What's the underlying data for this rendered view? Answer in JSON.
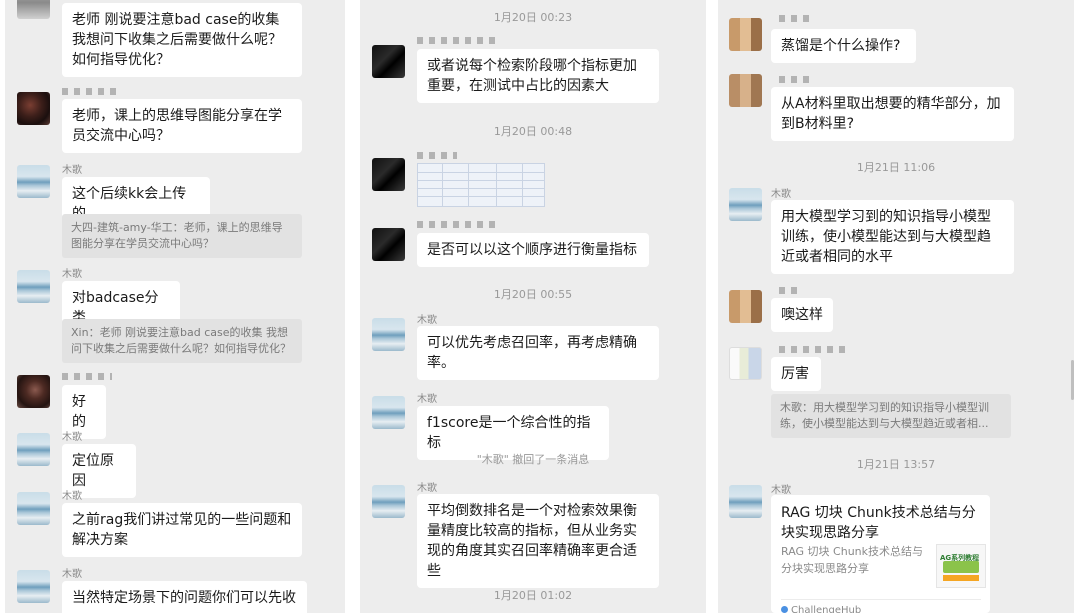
{
  "col1": {
    "msg1": "老师 刚说要注意bad case的收集 我想问下收集之后需要做什么呢？如何指导优化？",
    "msg2": "老师，课上的思维导图能分享在学员交流中心吗？",
    "mu_name": "木歌",
    "msg3": "这个后续kk会上传的",
    "quote1": "大四-建筑-amy-华工：老师，课上的思维导图能分享在学员交流中心吗？",
    "msg4": "对badcase分类",
    "quote2": "Xin：老师 刚说要注意bad case的收集 我想问下收集之后需要做什么呢？如何指导优化？",
    "msg5": "好的",
    "msg6": "定位原因",
    "msg7": "之前rag我们讲过常见的一些问题和解决方案",
    "msg8": "当然特定场景下的问题你们可以先收"
  },
  "col2": {
    "time1": "1月20日 00:23",
    "msg1": "或者说每个检索阶段哪个指标更加重要，在测试中占比的因素大",
    "time2": "1月20日 00:48",
    "msg2": "是否可以以这个顺序进行衡量指标",
    "time3": "1月20日 00:55",
    "mu_name": "木歌",
    "msg3": "可以优先考虑召回率，再考虑精确率。",
    "msg4": "f1score是一个综合性的指标",
    "recall": "\"木歌\" 撤回了一条消息",
    "msg5": "平均倒数排名是一个对检索效果衡量精度比较高的指标，但从业务实现的角度其实召回率精确率更合适些",
    "time4": "1月20日 01:02"
  },
  "col3": {
    "msg1": "蒸馏是个什么操作?",
    "msg2": "从A材料里取出想要的精华部分，加到B材料里?",
    "time1": "1月21日 11:06",
    "mu_name": "木歌",
    "msg3": "用大模型学习到的知识指导小模型训练，使小模型能达到与大模型趋近或者相同的水平",
    "msg4": "噢这样",
    "msg5": "厉害",
    "quote1": "木歌：用大模型学习到的知识指导小模型训练，使小模型能达到与大模型趋近或者相...",
    "time2": "1月21日 13:57",
    "card_title": "RAG 切块 Chunk技术总结与分块实现思路分享",
    "card_desc": "RAG 切块 Chunk技术总结与分块实现思路分享",
    "card_thumb_label": "AG系列教程",
    "card_source": "ChallengeHub"
  }
}
